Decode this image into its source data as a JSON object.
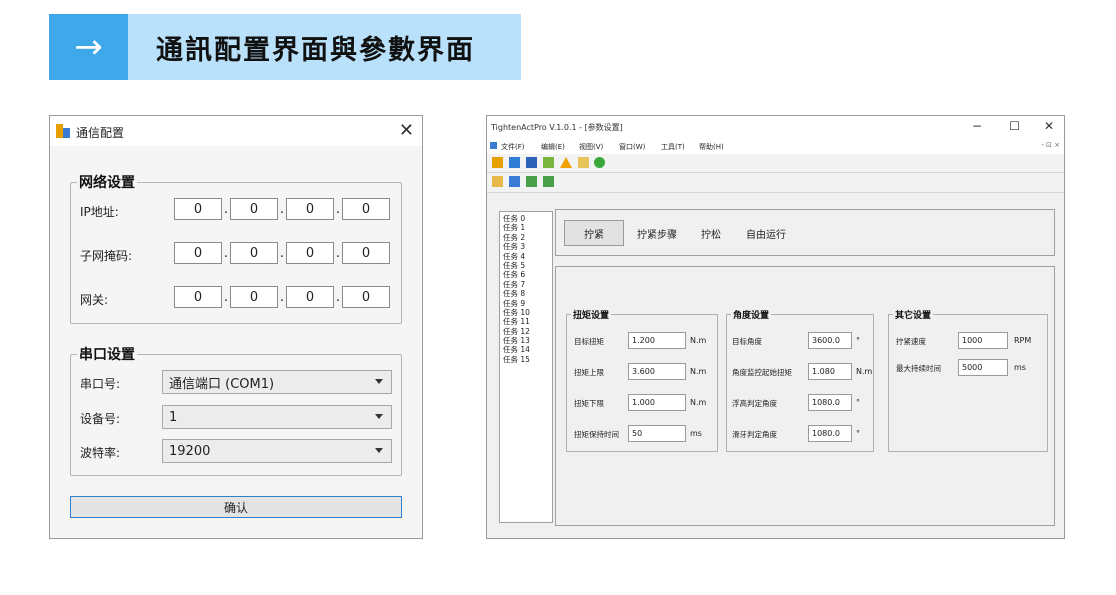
{
  "header": {
    "arrow": "→",
    "title": "通訊配置界面與參數界面"
  },
  "comm_dialog": {
    "title": "通信配置",
    "close": "✕",
    "network": {
      "legend": "网络设置",
      "fields": [
        {
          "label": "IP地址:",
          "octets": [
            "0",
            "0",
            "0",
            "0"
          ]
        },
        {
          "label": "子网掩码:",
          "octets": [
            "0",
            "0",
            "0",
            "0"
          ]
        },
        {
          "label": "网关:",
          "octets": [
            "0",
            "0",
            "0",
            "0"
          ]
        }
      ]
    },
    "serial": {
      "legend": "串口设置",
      "fields": [
        {
          "label": "串口号:",
          "value": "通信端口 (COM1)"
        },
        {
          "label": "设备号:",
          "value": "1"
        },
        {
          "label": "波特率:",
          "value": "19200"
        }
      ]
    },
    "confirm": "确认"
  },
  "param_window": {
    "title": "TightenActPro V.1.0.1 - [参数设置]",
    "controls": {
      "minimize": "−",
      "maximize": "☐",
      "close": "✕"
    },
    "menus": [
      "文件(F)",
      "编辑(E)",
      "视图(V)",
      "窗口(W)",
      "工具(T)",
      "帮助(H)"
    ],
    "mdi_controls": "- ⊡ ×",
    "tasks": [
      "任务 0",
      "任务 1",
      "任务 2",
      "任务 3",
      "任务 4",
      "任务 5",
      "任务 6",
      "任务 7",
      "任务 8",
      "任务 9",
      "任务 10",
      "任务 11",
      "任务 12",
      "任务 13",
      "任务 14",
      "任务 15"
    ],
    "tabs": [
      "拧紧",
      "拧紧步骤",
      "拧松",
      "自由运行"
    ],
    "torque": {
      "legend": "扭矩设置",
      "rows": [
        {
          "label": "目标扭矩",
          "value": "1.200",
          "unit": "N.m"
        },
        {
          "label": "扭矩上限",
          "value": "3.600",
          "unit": "N.m"
        },
        {
          "label": "扭矩下限",
          "value": "1.000",
          "unit": "N.m"
        },
        {
          "label": "扭矩保持时间",
          "value": "50",
          "unit": "ms"
        }
      ]
    },
    "angle": {
      "legend": "角度设置",
      "rows": [
        {
          "label": "目标角度",
          "value": "3600.0",
          "unit": "°"
        },
        {
          "label": "角度监控起始扭矩",
          "value": "1.080",
          "unit": "N.m"
        },
        {
          "label": "浮高判定角度",
          "value": "1080.0",
          "unit": "°"
        },
        {
          "label": "滑牙判定角度",
          "value": "1080.0",
          "unit": "°"
        }
      ]
    },
    "other": {
      "legend": "其它设置",
      "rows": [
        {
          "label": "拧紧速度",
          "value": "1000",
          "unit": "RPM"
        },
        {
          "label": "最大持续时间",
          "value": "5000",
          "unit": "ms"
        }
      ]
    }
  }
}
